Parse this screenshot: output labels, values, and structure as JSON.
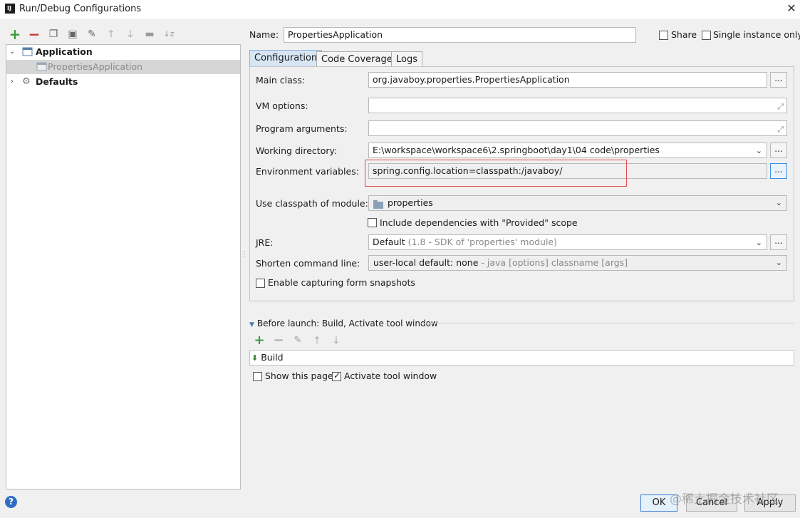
{
  "window": {
    "title": "Run/Debug Configurations",
    "app_icon": "IJ"
  },
  "toolbar": {
    "icons": [
      "add-icon",
      "remove-icon",
      "copy-icon",
      "save-icon",
      "wrench-icon",
      "move-up-icon",
      "move-down-icon",
      "folder-icon",
      "sort-icon"
    ]
  },
  "tree": {
    "application": "Application",
    "child": "PropertiesApplication",
    "defaults": "Defaults"
  },
  "name": {
    "label": "Name:",
    "value": "PropertiesApplication"
  },
  "share": {
    "label": "Share",
    "checked": false
  },
  "single_instance": {
    "label": "Single instance only",
    "checked": false
  },
  "tabs": [
    "Configuration",
    "Code Coverage",
    "Logs"
  ],
  "form": {
    "main_class": {
      "label": "Main class:",
      "value": "org.javaboy.properties.PropertiesApplication",
      "button": "..."
    },
    "vm_options": {
      "label": "VM options:",
      "value": ""
    },
    "program_arguments": {
      "label": "Program arguments:",
      "value": ""
    },
    "working_directory": {
      "label": "Working directory:",
      "value": "E:\\workspace\\workspace6\\2.springboot\\day1\\04 code\\properties",
      "button": "..."
    },
    "environment_variables": {
      "label": "Environment variables:",
      "value": "spring.config.location=classpath:/javaboy/",
      "button": "..."
    },
    "classpath_module": {
      "label": "Use classpath of module:",
      "value": "properties"
    },
    "include_provided": {
      "label": "Include dependencies with \"Provided\" scope",
      "checked": false
    },
    "jre": {
      "label": "JRE:",
      "value": "Default",
      "hint": "(1.8 - SDK of 'properties' module)",
      "button": "..."
    },
    "shorten_command_line": {
      "label": "Shorten command line:",
      "value": "user-local default: none",
      "hint": "- java [options] classname [args]"
    },
    "enable_snapshots": {
      "label": "Enable capturing form snapshots",
      "checked": false
    }
  },
  "before_launch": {
    "title": "Before launch: Build, Activate tool window",
    "item": "Build",
    "show_page": {
      "label": "Show this page",
      "checked": false
    },
    "activate_window": {
      "label": "Activate tool window",
      "checked": true
    }
  },
  "buttons": {
    "help": "?",
    "ok": "OK",
    "cancel": "Cancel",
    "apply": "Apply"
  },
  "watermark": "@稀土掘金技术社区",
  "colors": {
    "highlight": "#e04a4a",
    "selected_row": "#d6d6d6",
    "active_tab": "#d7e6f5",
    "accent": "#3c7fd6"
  }
}
